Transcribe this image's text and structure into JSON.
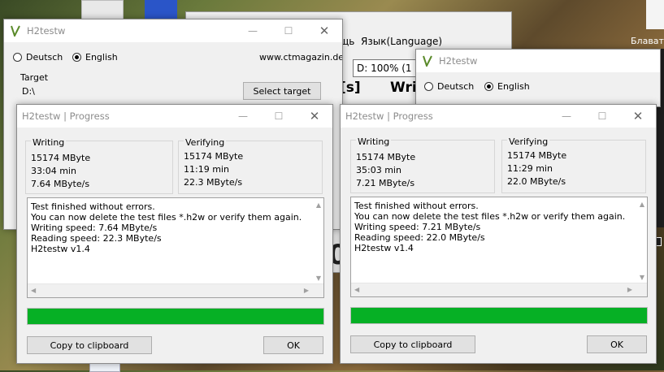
{
  "background": {
    "menu_fragment": "щь  Язык(Language)",
    "status_fragment": "D: 100% (1",
    "big_text_left": "[s]",
    "big_text_right": "Wri",
    "side_label": "Блават",
    "big_digit": "0"
  },
  "main_window": {
    "title": "H2testw",
    "radio_deutsch": "Deutsch",
    "radio_english": "English",
    "url": "www.ctmagazin.de",
    "target_label": "Target",
    "target_value": "D:\\",
    "select_target_button": "Select target"
  },
  "second_window": {
    "title": "H2testw",
    "radio_deutsch": "Deutsch",
    "radio_english": "English"
  },
  "progress_left": {
    "title": "H2testw | Progress",
    "writing": {
      "label": "Writing",
      "size": "15174 MByte",
      "time": "33:04 min",
      "speed": "7.64 MByte/s"
    },
    "verifying": {
      "label": "Verifying",
      "size": "15174 MByte",
      "time": "11:19 min",
      "speed": "22.3 MByte/s"
    },
    "log": [
      "Test finished without errors.",
      "You can now delete the test files *.h2w or verify them again.",
      "Writing speed: 7.64 MByte/s",
      "Reading speed: 22.3 MByte/s",
      "H2testw v1.4"
    ],
    "progress_percent": 100,
    "copy_button": "Copy to clipboard",
    "ok_button": "OK"
  },
  "progress_right": {
    "title": "H2testw | Progress",
    "writing": {
      "label": "Writing",
      "size": "15174 MByte",
      "time": "35:03 min",
      "speed": "7.21 MByte/s"
    },
    "verifying": {
      "label": "Verifying",
      "size": "15174 MByte",
      "time": "11:29 min",
      "speed": "22.0 MByte/s"
    },
    "log": [
      "Test finished without errors.",
      "You can now delete the test files *.h2w or verify them again.",
      "Writing speed: 7.21 MByte/s",
      "Reading speed: 22.0 MByte/s",
      "H2testw v1.4"
    ],
    "progress_percent": 100,
    "copy_button": "Copy to clipboard",
    "ok_button": "OK"
  },
  "colors": {
    "progress_fill": "#06b025"
  },
  "icons": {
    "app": "h2testw-app-icon",
    "minimize": "minimize-icon",
    "maximize": "maximize-icon",
    "close": "close-icon"
  }
}
